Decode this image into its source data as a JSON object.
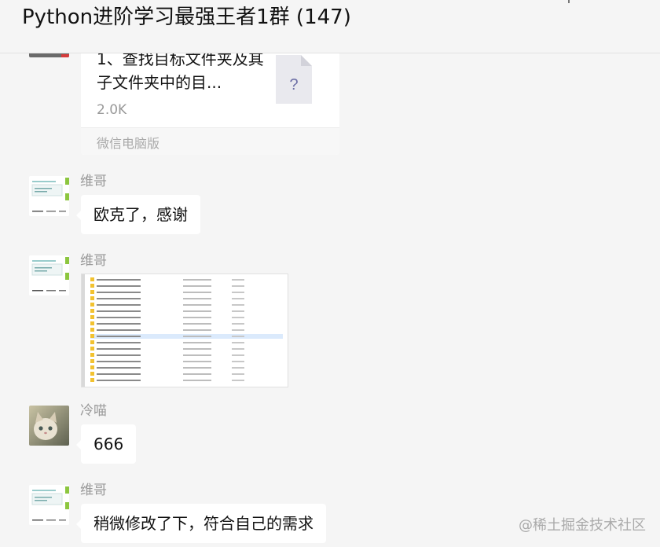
{
  "window": {
    "title": "Python进阶学习最强王者1群 (147)"
  },
  "messages": {
    "file": {
      "name": "1、查找目标文件夹及其子文件夹中的目...",
      "size": "2.0K",
      "source": "微信电脑版"
    },
    "m1": {
      "sender": "维哥",
      "text": "欧克了，感谢"
    },
    "m2": {
      "sender": "维哥",
      "image": "screenshot-file-list"
    },
    "m3": {
      "sender": "冷喵",
      "text": "666"
    },
    "m4": {
      "sender": "维哥",
      "text": "稍微修改了下，符合自己的需求"
    }
  },
  "watermark": "@稀土掘金技术社区",
  "colors": {
    "bubble": "#ffffff",
    "background": "#f5f5f5",
    "sender": "#999999"
  }
}
